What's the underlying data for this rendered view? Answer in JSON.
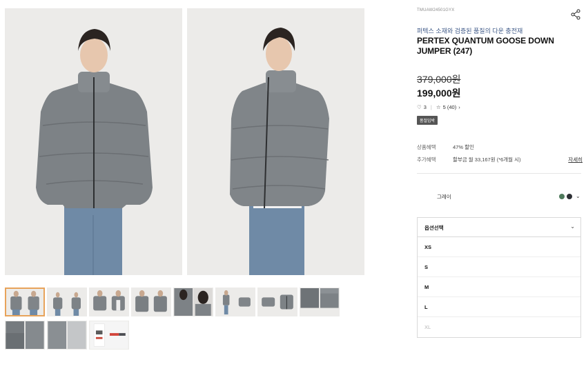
{
  "product": {
    "code": "TMUAW24501GYX",
    "subtitle": "퍼텍스 소재와 검증된 품질의 다운 충전재",
    "title": "PERTEX QUANTUM GOOSE DOWN JUMPER (247)",
    "price_original": "379,000원",
    "price_sale": "199,000원",
    "likes": "3",
    "rating": "5 (40)",
    "badge": "품절임박"
  },
  "benefits": [
    {
      "label": "상품혜택",
      "value": "47% 할인"
    },
    {
      "label": "추가혜택",
      "value": "할부금 월 33,167원 (*6개월 시)",
      "link": "자세히"
    }
  ],
  "color": {
    "selected": "그레이",
    "swatches": [
      {
        "name": "green-swatch",
        "color": "#4f7a5c"
      },
      {
        "name": "dark-swatch",
        "color": "#2e3035"
      }
    ]
  },
  "size_select": {
    "label": "옵션선택",
    "options": [
      {
        "label": "XS",
        "available": true
      },
      {
        "label": "S",
        "available": true
      },
      {
        "label": "M",
        "available": true
      },
      {
        "label": "L",
        "available": true
      },
      {
        "label": "XL",
        "available": false
      }
    ]
  },
  "colors": {
    "jacket": "#7d8286",
    "jeans": "#6f8aa6",
    "thumb_active_border": "#e8a35a",
    "subtitle": "#3f5a88"
  }
}
